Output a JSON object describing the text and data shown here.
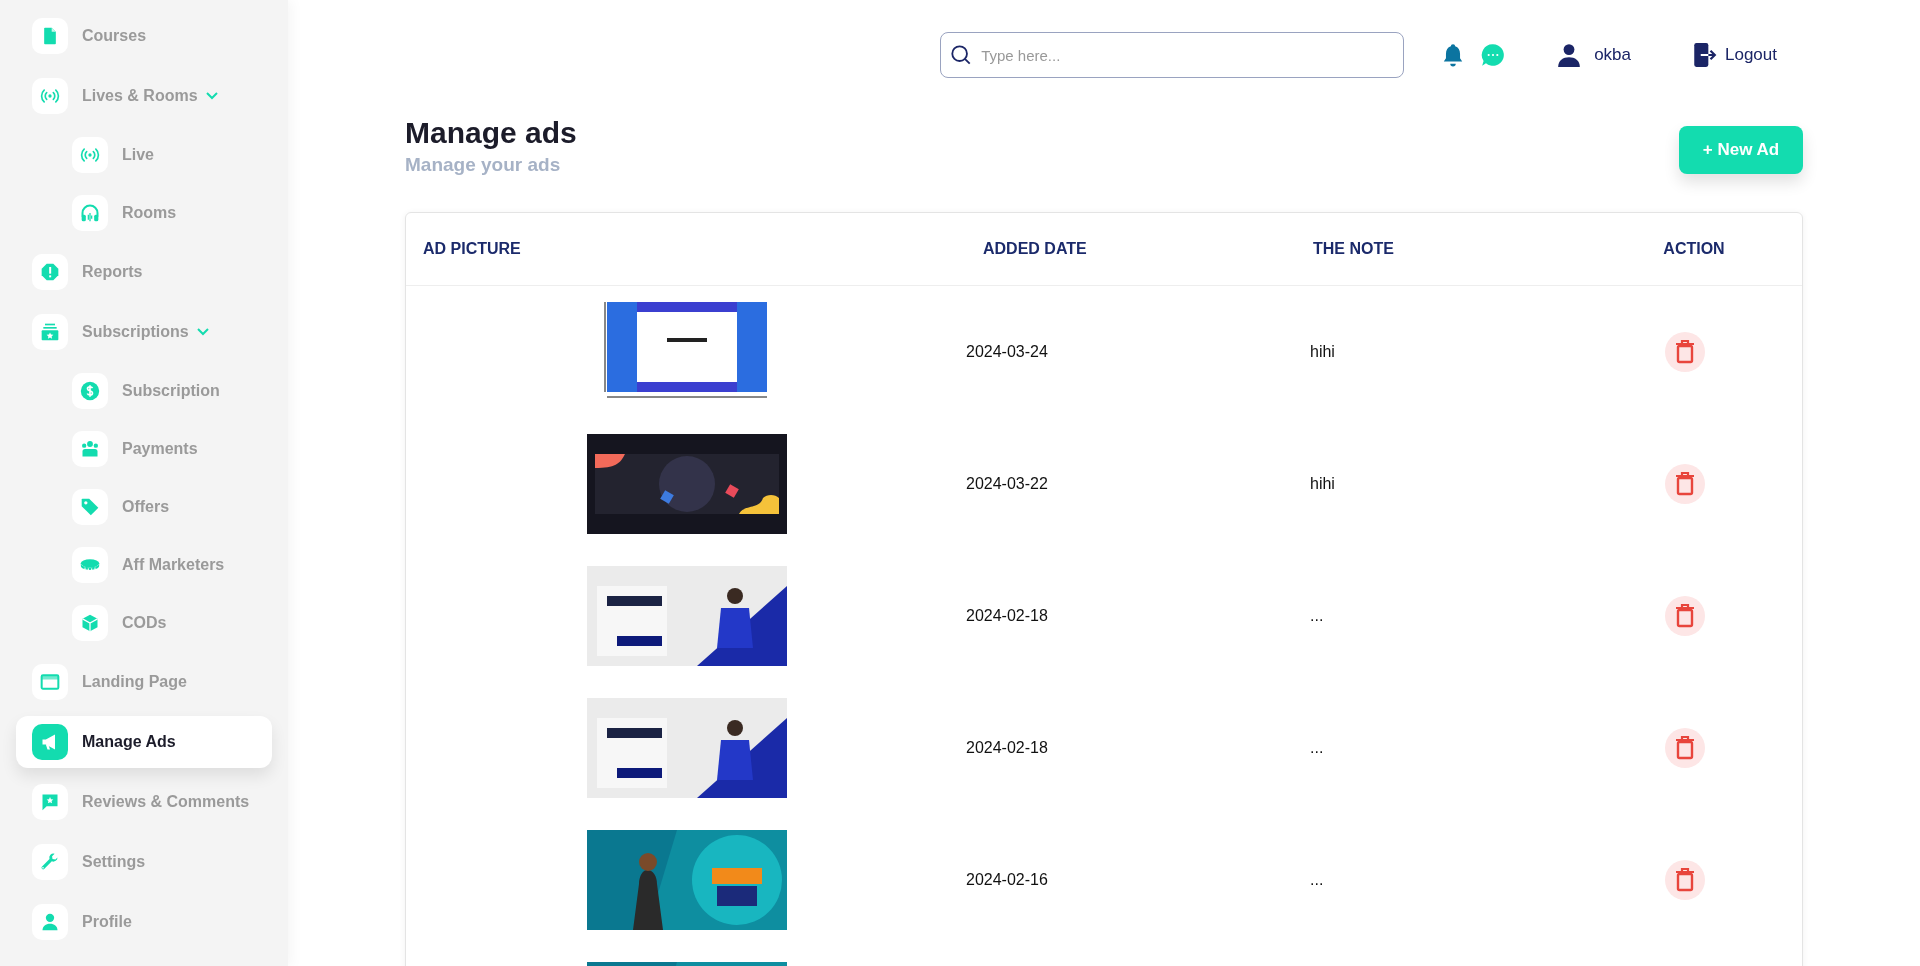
{
  "sidebar": {
    "items": [
      {
        "label": "Courses",
        "selected": false
      },
      {
        "label": "Lives & Rooms",
        "selected": false,
        "expanded": true,
        "children": [
          {
            "label": "Live",
            "selected": false
          },
          {
            "label": "Rooms",
            "selected": false
          }
        ]
      },
      {
        "label": "Reports",
        "selected": false
      },
      {
        "label": "Subscriptions",
        "selected": false,
        "expanded": true,
        "children": [
          {
            "label": "Subscription",
            "selected": false
          },
          {
            "label": "Payments",
            "selected": false
          },
          {
            "label": "Offers",
            "selected": false
          },
          {
            "label": "Aff Marketers",
            "selected": false
          },
          {
            "label": "CODs",
            "selected": false
          }
        ]
      },
      {
        "label": "Landing Page",
        "selected": false
      },
      {
        "label": "Manage Ads",
        "selected": true
      },
      {
        "label": "Reviews & Comments",
        "selected": false
      },
      {
        "label": "Settings",
        "selected": false
      },
      {
        "label": "Profile",
        "selected": false
      }
    ]
  },
  "header": {
    "search": {
      "placeholder": "Type here..."
    },
    "user": "okba",
    "logout": "Logout"
  },
  "page": {
    "title": "Manage ads",
    "subtitle": "Manage your ads",
    "new_button": "+ New Ad"
  },
  "table": {
    "columns": [
      "AD PICTURE",
      "ADDED DATE",
      "THE NOTE",
      "ACTION"
    ],
    "rows": [
      {
        "picture": {
          "kind": "picture"
        },
        "date": "2024-03-24",
        "note": "hihi"
      },
      {
        "picture": {
          "kind": "picture"
        },
        "date": "2024-03-22",
        "note": "hihi"
      },
      {
        "picture": {
          "kind": "picture"
        },
        "date": "2024-02-18",
        "note": "..."
      },
      {
        "picture": {
          "kind": "picture"
        },
        "date": "2024-02-18",
        "note": "..."
      },
      {
        "picture": {
          "kind": "picture"
        },
        "date": "2024-02-16",
        "note": "..."
      },
      {
        "picture": {
          "kind": "picture"
        }
      }
    ]
  }
}
